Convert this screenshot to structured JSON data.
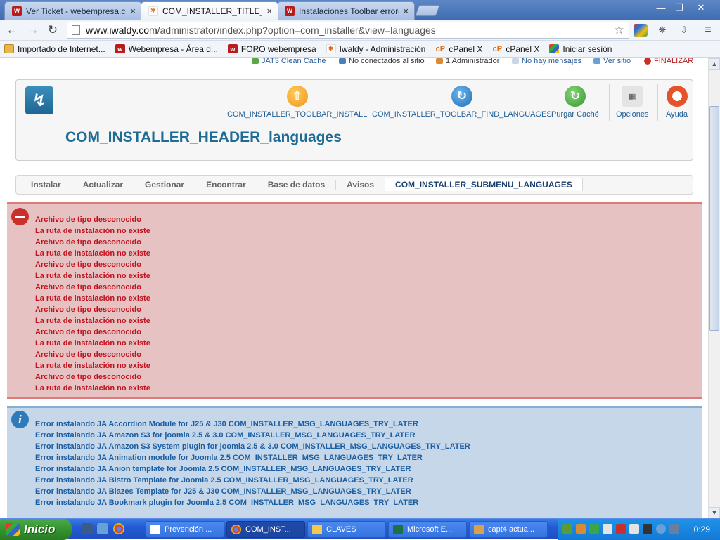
{
  "browser": {
    "tabs": [
      {
        "label": "Ver Ticket - webempresa.con",
        "icon": "webempresa-icon",
        "close": "×"
      },
      {
        "label": "COM_INSTALLER_TITLE_lang",
        "icon": "joomla-icon",
        "close": "×"
      },
      {
        "label": "Instalaciones Toolbar errore",
        "icon": "webempresa-icon",
        "close": "×"
      }
    ],
    "url_host": "www.iwaldy.com",
    "url_path": "/administrator/index.php?option=com_installer&view=languages",
    "bookmarks": [
      {
        "label": "Importado de Internet...",
        "icon": "folder-icon"
      },
      {
        "label": "Webempresa - Área d...",
        "icon": "webempresa-icon"
      },
      {
        "label": "FORO webempresa",
        "icon": "webempresa-icon"
      },
      {
        "label": "Iwaldy - Administración",
        "icon": "joomla-icon"
      },
      {
        "label": "cPanel X",
        "icon": "cpanel-icon"
      },
      {
        "label": "cPanel X",
        "icon": "cpanel-icon"
      },
      {
        "label": "Iniciar sesión",
        "icon": "windows-icon"
      }
    ]
  },
  "status_bar": {
    "cache": "JAT3 Clean Cache",
    "visitors": "No conectados al sitio",
    "admins": "1 Administrador",
    "messages": "No hay mensajes",
    "view_site": "Ver sitio",
    "logout": "FINALIZAR"
  },
  "toolbar": {
    "install": "COM_INSTALLER_TOOLBAR_INSTALL",
    "find_languages": "COM_INSTALLER_TOOLBAR_FIND_LANGUAGES",
    "purge_cache": "Purgar Caché",
    "options": "Opciones",
    "help": "Ayuda"
  },
  "page_title": "COM_INSTALLER_HEADER_languages",
  "submenu": [
    "Instalar",
    "Actualizar",
    "Gestionar",
    "Encontrar",
    "Base de datos",
    "Avisos",
    "COM_INSTALLER_SUBMENU_LANGUAGES"
  ],
  "errors": [
    "Archivo de tipo desconocido",
    "La ruta de instalación no existe",
    "Archivo de tipo desconocido",
    "La ruta de instalación no existe",
    "Archivo de tipo desconocido",
    "La ruta de instalación no existe",
    "Archivo de tipo desconocido",
    "La ruta de instalación no existe",
    "Archivo de tipo desconocido",
    "La ruta de instalación no existe",
    "Archivo de tipo desconocido",
    "La ruta de instalación no existe",
    "Archivo de tipo desconocido",
    "La ruta de instalación no existe",
    "Archivo de tipo desconocido",
    "La ruta de instalación no existe"
  ],
  "info_messages": [
    "Error instalando JA Accordion Module for J25 & J30 COM_INSTALLER_MSG_LANGUAGES_TRY_LATER",
    "Error instalando JA Amazon S3 for joomla 2.5 & 3.0 COM_INSTALLER_MSG_LANGUAGES_TRY_LATER",
    "Error instalando JA Amazon S3 System plugin for joomla 2.5 & 3.0 COM_INSTALLER_MSG_LANGUAGES_TRY_LATER",
    "Error instalando JA Animation module for Joomla 2.5 COM_INSTALLER_MSG_LANGUAGES_TRY_LATER",
    "Error instalando JA Anion template for Joomla 2.5 COM_INSTALLER_MSG_LANGUAGES_TRY_LATER",
    "Error instalando JA Bistro Template for Joomla 2.5 COM_INSTALLER_MSG_LANGUAGES_TRY_LATER",
    "Error instalando JA Blazes Template for J25 & J30 COM_INSTALLER_MSG_LANGUAGES_TRY_LATER",
    "Error instalando JA Bookmark plugin for Joomla 2.5 COM_INSTALLER_MSG_LANGUAGES_TRY_LATER"
  ],
  "taskbar": {
    "start": "Inicio",
    "tasks": [
      "Prevención ...",
      "COM_INST...",
      "CLAVES",
      "Microsoft E...",
      "capt4 actua..."
    ],
    "clock": "0:29"
  },
  "colors": {
    "error_bg": "#e7c2c2",
    "error_text": "#c1121f",
    "info_bg": "#c5d7e9",
    "info_text": "#1a5ea3",
    "title": "#1e6b95"
  }
}
